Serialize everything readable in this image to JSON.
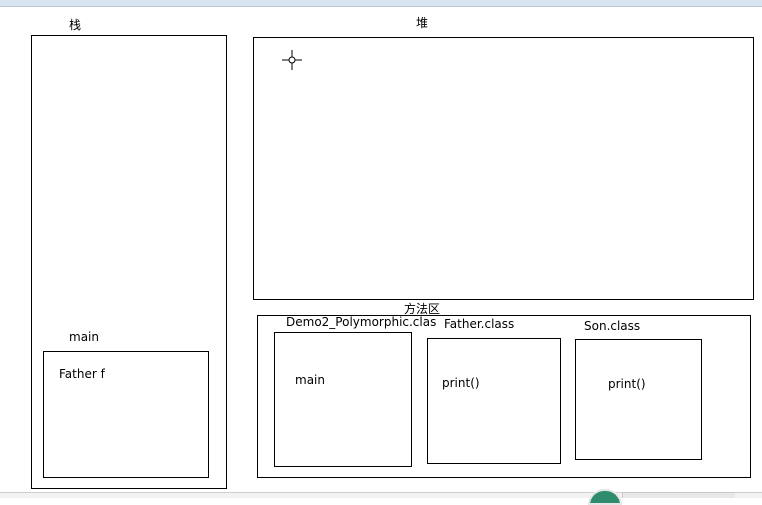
{
  "stack": {
    "title": "栈",
    "frame_label": "main",
    "frame_var": "Father f"
  },
  "heap": {
    "title": "堆"
  },
  "method_area": {
    "title": "方法区",
    "classes": [
      {
        "name": "Demo2_Polymorphic.clas",
        "member": "main"
      },
      {
        "name": "Father.class",
        "member": "print()"
      },
      {
        "name": "Son.class",
        "member": "print()"
      }
    ]
  },
  "icons": {
    "cursor": "crosshair-cursor-icon"
  }
}
